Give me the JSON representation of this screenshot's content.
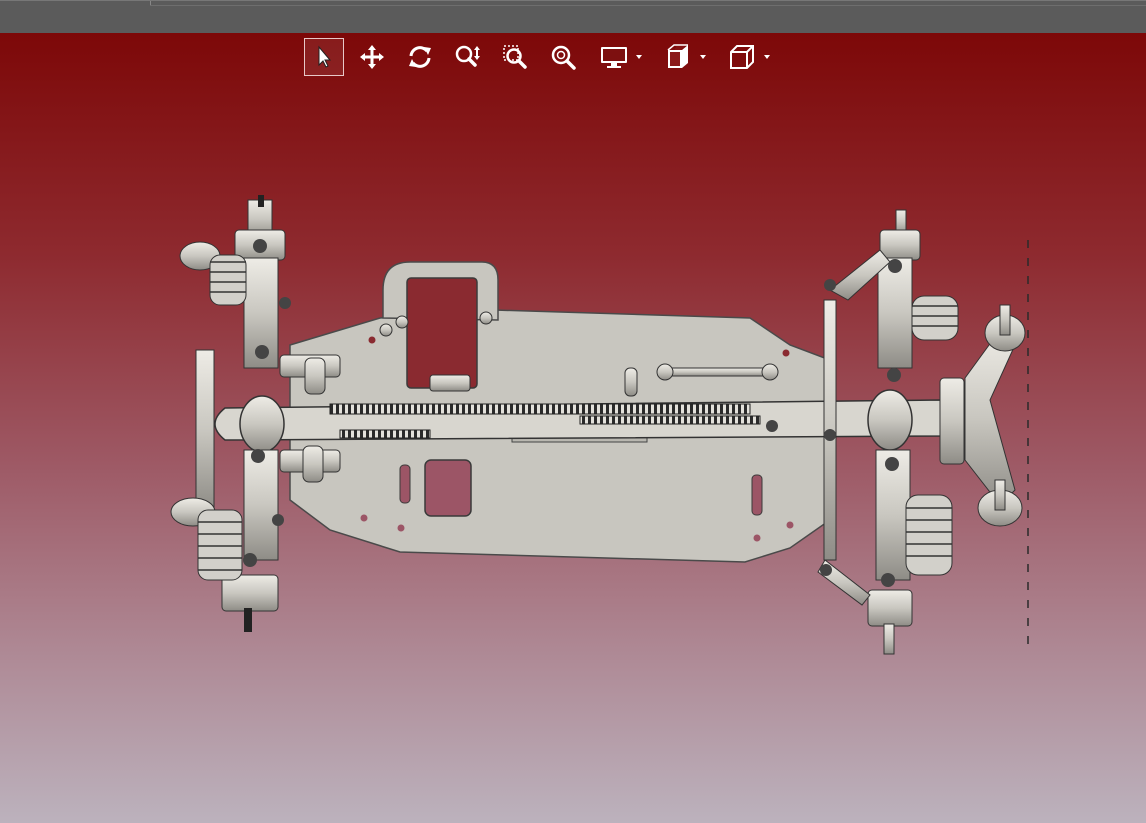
{
  "window": {
    "title": ""
  },
  "viewport": {
    "background_top": "#7d0808",
    "background_bottom": "#bcb2bd",
    "model_name": "",
    "model_part_color": "#cfcdc6"
  },
  "toolbar": {
    "tools": [
      {
        "name": "select-tool",
        "icon": "cursor-arrow-icon",
        "active": true
      },
      {
        "name": "pan-tool",
        "icon": "move-arrows-icon",
        "active": false
      },
      {
        "name": "rotate-tool",
        "icon": "rotate-icon",
        "active": false
      },
      {
        "name": "zoom-tool",
        "icon": "zoom-updown-icon",
        "active": false
      },
      {
        "name": "zoom-window-tool",
        "icon": "zoom-window-icon",
        "active": false
      },
      {
        "name": "zoom-fit-tool",
        "icon": "zoom-fit-icon",
        "active": false
      },
      {
        "name": "display-style-dropdown",
        "icon": "monitor-icon",
        "has_menu": true
      },
      {
        "name": "section-view-dropdown",
        "icon": "section-view-icon",
        "has_menu": true
      },
      {
        "name": "view-orientation-dropdown",
        "icon": "cube-icon",
        "has_menu": true
      }
    ]
  }
}
